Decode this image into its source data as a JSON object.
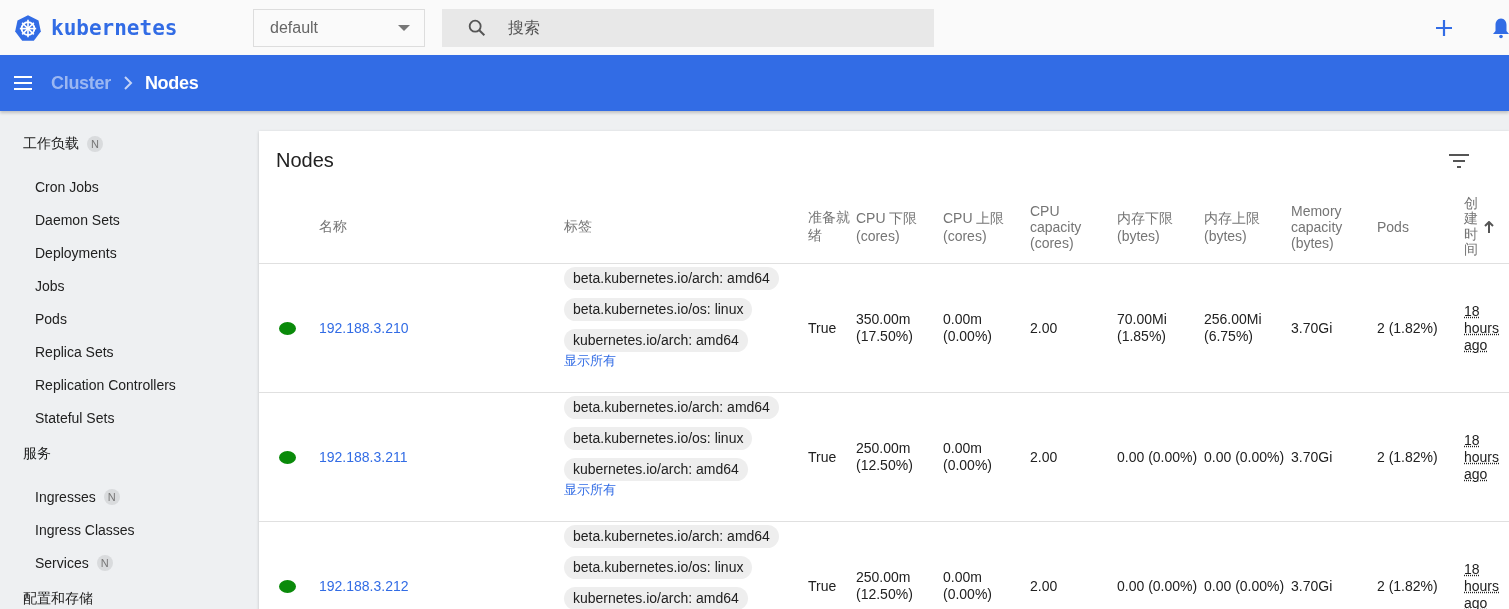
{
  "header": {
    "logo_text": "kubernetes",
    "namespace": "default",
    "search": {
      "placeholder": "搜索"
    }
  },
  "toolbar": {
    "breadcrumbs": [
      {
        "label": "Cluster",
        "current": false
      },
      {
        "label": "Nodes",
        "current": true
      }
    ]
  },
  "sidebar": {
    "sections": [
      {
        "title": "工作负载",
        "badge": "N",
        "items": [
          {
            "label": "Cron Jobs"
          },
          {
            "label": "Daemon Sets"
          },
          {
            "label": "Deployments"
          },
          {
            "label": "Jobs"
          },
          {
            "label": "Pods"
          },
          {
            "label": "Replica Sets"
          },
          {
            "label": "Replication Controllers"
          },
          {
            "label": "Stateful Sets"
          }
        ]
      },
      {
        "title": "服务",
        "items": [
          {
            "label": "Ingresses",
            "badge": "N"
          },
          {
            "label": "Ingress Classes"
          },
          {
            "label": "Services",
            "badge": "N"
          }
        ]
      },
      {
        "title": "配置和存储"
      }
    ]
  },
  "card": {
    "title": "Nodes",
    "table": {
      "columns": [
        {
          "label": "名称",
          "kind": "text"
        },
        {
          "label": "标签",
          "kind": "text"
        },
        {
          "label": "准备就绪",
          "kind": "text"
        },
        {
          "label": "CPU 下限 (cores)",
          "kind": "text"
        },
        {
          "label": "CPU 上限 (cores)",
          "kind": "text"
        },
        {
          "label": "CPU capacity (cores)",
          "kind": "text"
        },
        {
          "label": "内存下限 (bytes)",
          "kind": "text"
        },
        {
          "label": "内存上限 (bytes)",
          "kind": "text"
        },
        {
          "label": "Memory capacity (bytes)",
          "kind": "text"
        },
        {
          "label": "Pods",
          "kind": "text"
        },
        {
          "label": "创建时间",
          "kind": "vertical",
          "sorted": true
        }
      ],
      "rows": [
        {
          "color": "#0a8a0a",
          "name": "192.188.3.210",
          "labels": [
            "beta.kubernetes.io/arch: amd64",
            "beta.kubernetes.io/os: linux",
            "kubernetes.io/arch: amd64"
          ],
          "show_all": "显示所有",
          "ready": "True",
          "cpu_requests": "350.00m (17.50%)",
          "cpu_limits": "0.00m (0.00%)",
          "cpu_capacity": "2.00",
          "memory_requests": "70.00Mi (1.85%)",
          "memory_limits": "256.00Mi (6.75%)",
          "memory_capacity": "3.70Gi",
          "pods": "2 (1.82%)",
          "created": "18 hours ago"
        },
        {
          "color": "#0a8a0a",
          "name": "192.188.3.211",
          "labels": [
            "beta.kubernetes.io/arch: amd64",
            "beta.kubernetes.io/os: linux",
            "kubernetes.io/arch: amd64"
          ],
          "show_all": "显示所有",
          "ready": "True",
          "cpu_requests": "250.00m (12.50%)",
          "cpu_limits": "0.00m (0.00%)",
          "cpu_capacity": "2.00",
          "memory_requests": "0.00 (0.00%)",
          "memory_limits": "0.00 (0.00%)",
          "memory_capacity": "3.70Gi",
          "pods": "2 (1.82%)",
          "created": "18 hours ago"
        },
        {
          "color": "#0a8a0a",
          "name": "192.188.3.212",
          "labels": [
            "beta.kubernetes.io/arch: amd64",
            "beta.kubernetes.io/os: linux",
            "kubernetes.io/arch: amd64"
          ],
          "ready": "True",
          "cpu_requests": "250.00m (12.50%)",
          "cpu_limits": "0.00m (0.00%)",
          "cpu_capacity": "2.00",
          "memory_requests": "0.00 (0.00%)",
          "memory_limits": "0.00 (0.00%)",
          "memory_capacity": "3.70Gi",
          "pods": "2 (1.82%)",
          "created": "18 hours ago"
        }
      ]
    }
  }
}
